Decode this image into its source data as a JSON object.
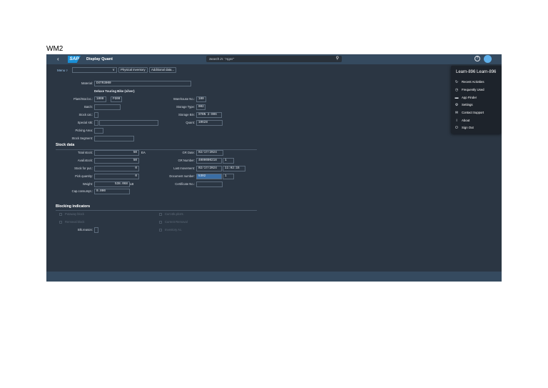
{
  "doc_label": "WM2",
  "shell": {
    "back": "‹",
    "logo": "SAP",
    "title": "Display Quant",
    "search_placeholder": "Search in: \"Apps\"",
    "search_icon": "⚲",
    "help_icon": "?"
  },
  "toolbar": {
    "menu": "Menu ▿",
    "cmd_chevron": "∨",
    "buttons": [
      "Physical inventory",
      "Additional data..."
    ]
  },
  "header": {
    "material_label": "Material:",
    "material_value": "DXTR3000",
    "material_desc": "Deluxe Touring Bike (silver)",
    "plant_label": "Plant/Stor.loc.:",
    "plant_value": "1000",
    "sloc_value": "FG00",
    "batch_label": "Batch:",
    "batch_value": "",
    "stockcat_label": "Stock cat.:",
    "stockcat_value": "",
    "special_label": "Special stk:",
    "special_value": "",
    "special_value2": "",
    "picking_label": "Picking Area:",
    "picking_value": "",
    "segment_label": "Stock Segment:",
    "segment_value": "",
    "whse_label": "Warehouse No.:",
    "whse_value": "100",
    "stype_label": "Storage Type:",
    "stype_value": "002",
    "sbin_label": "Storage Bin:",
    "sbin_value": "STBN 2-006",
    "quant_label": "Quant:",
    "quant_value": "10628"
  },
  "stock": {
    "section_title": "Stock data",
    "total_label": "Total stock:",
    "total_value": "50",
    "total_uom": "EA",
    "avail_label": "Avail.stock:",
    "avail_value": "50",
    "putaway_label": "Stock for put.:",
    "putaway_value": "0",
    "pick_label": "Pick quantity:",
    "pick_value": "0",
    "weight_label": "Weight:",
    "weight_value": "538.068",
    "weight_uom": "LB",
    "cap_label": "Cap.consumpt.:",
    "cap_value": "0.000",
    "gr_date_label": "GR Date:",
    "gr_date_value": "02/17/2024",
    "gr_number_label": "GR Number:",
    "gr_number_value": "4000000218",
    "gr_number_item": "1",
    "last_move_label": "Last movement:",
    "last_move_date": "02/17/2024",
    "last_move_time": "11:02:15",
    "docnum_label": "Document number:",
    "docnum_value": "5302",
    "docnum_item": "1",
    "cert_label": "Certificate No.:",
    "cert_value": ""
  },
  "blocking": {
    "section_title": "Blocking indicators",
    "left_items": [
      "Putaway block",
      "Removal block"
    ],
    "right_items": [
      "Curr.stk.plcmt.",
      "Current Removal",
      "Inventory Ac."
    ],
    "blk_reason_label": "Blk.reason:",
    "blk_reason_value": ""
  },
  "user_menu": {
    "title": "Learn-896 Learn-896",
    "items": [
      {
        "icon": "recent-activities-icon",
        "glyph": "↻",
        "label": "Recent Activities"
      },
      {
        "icon": "frequently-used-icon",
        "glyph": "◷",
        "label": "Frequently Used"
      },
      {
        "icon": "app-finder-icon",
        "glyph": "▬",
        "label": "App Finder"
      },
      {
        "icon": "settings-icon",
        "glyph": "⚙",
        "label": "Settings"
      },
      {
        "icon": "contact-support-icon",
        "glyph": "✉",
        "label": "Contact Support"
      },
      {
        "icon": "about-icon",
        "glyph": "i",
        "label": "About"
      },
      {
        "icon": "sign-out-icon",
        "glyph": "⏻",
        "label": "Sign Out"
      }
    ]
  }
}
